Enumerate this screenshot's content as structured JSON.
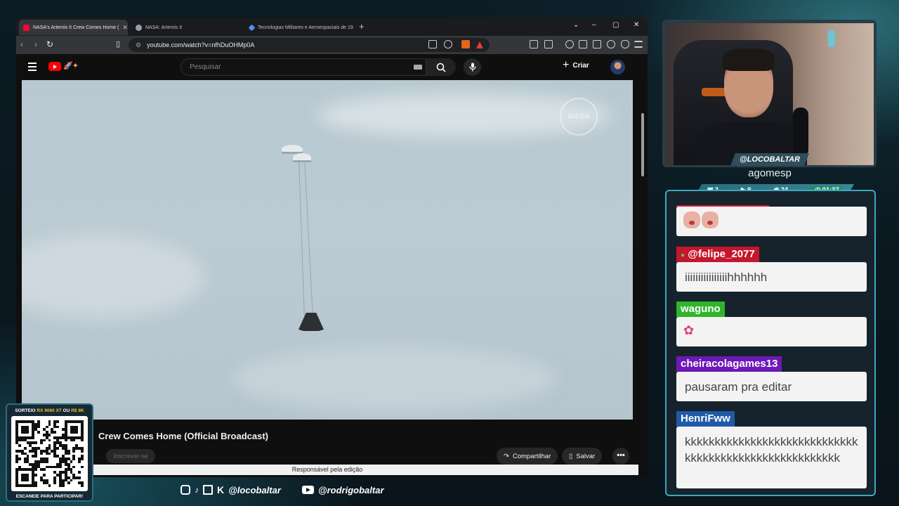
{
  "browser": {
    "tabs": [
      {
        "title": "NASA's Artemis II Crew Comes Home (",
        "active": true,
        "favicon_color": "#ff0033"
      },
      {
        "title": "NASA: Artemis II",
        "active": false,
        "favicon_color": "#9aa0a6"
      },
      {
        "title": "Tecnologias Militares e Aeroespaciais de 19",
        "active": false,
        "favicon_color": "#4f8ff7"
      }
    ],
    "new_tab_label": "+",
    "url": "youtube.com/watch?v=nfhDuOHMp0A",
    "window_controls": {
      "dropdown": "⌄",
      "minimize": "–",
      "maximize": "▢",
      "close": "✕"
    }
  },
  "youtube": {
    "search_placeholder": "Pesquisar",
    "create_label": "Criar",
    "video_title": "Crew Comes Home (Official Broadcast)",
    "subscribe_label": "Inscrever-se",
    "share_label": "Compartilhar",
    "save_label": "Salvar",
    "more_label": "•••",
    "tooltip": "Responsável pela edição",
    "watermark": "NASA"
  },
  "stream": {
    "streamer_tag": "@LOCOBALTAR",
    "subtitle": "agomesp",
    "stats": {
      "chat": "2",
      "videos": "9",
      "viewers": "24",
      "timer": "01:37"
    }
  },
  "chat": {
    "messages": [
      {
        "user": "",
        "text": "",
        "emotes": 2
      },
      {
        "user": "@felipe_2077",
        "text": "iiiiiiiiiiiiiiiihhhhhh",
        "name_bg": "#c4162d"
      },
      {
        "user": "waguno",
        "text": "",
        "name_bg": "#2fb52a",
        "emotes": 1
      },
      {
        "user": "cheiracolagames13",
        "text": "pausaram pra editar",
        "name_bg": "#6c19b8"
      },
      {
        "user": "HenriFww",
        "text": "kkkkkkkkkkkkkkkkkkkkkkkkkkkkkkkkkkkkkkkkkkkkkkkkkkkkkkk",
        "name_bg": "#1f5aa8"
      }
    ]
  },
  "qr": {
    "top_prefix": "SORTEIO",
    "top_highlight": "RX 9060 XT",
    "top_mid": "OU",
    "top_highlight2": "R$ 8K",
    "bottom": "ESCANEIE PARA PARTICIPAR!"
  },
  "socials": {
    "handle1": "@locobaltar",
    "handle2": "@rodrigobaltar"
  }
}
